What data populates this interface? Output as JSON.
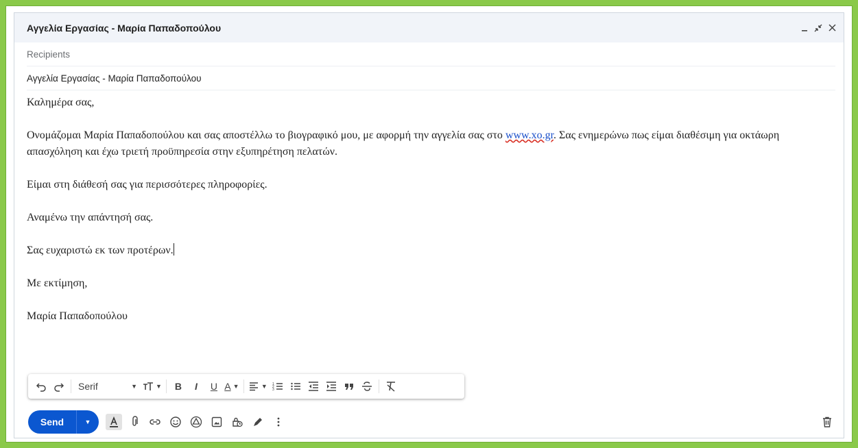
{
  "window": {
    "title": "Αγγελία Εργασίας - Μαρία Παπαδοπούλου",
    "minimize_icon": "minimize-icon",
    "expand_icon": "exit-fullscreen-icon",
    "close_icon": "close-icon"
  },
  "recipients": {
    "placeholder": "Recipients"
  },
  "subject": {
    "value": "Αγγελία Εργασίας - Μαρία Παπαδοπούλου"
  },
  "body": {
    "greeting": "Καλημέρα σας,",
    "para1_before": "Ονομάζομαι Μαρία Παπαδοπούλου και σας αποστέλλω το βιογραφικό μου, με αφορμή την αγγελία σας στο ",
    "para1_link": "www.xo.gr",
    "para1_after": ". Σας ενημερώνω πως είμαι διαθέσιμη για οκτάωρη απασχόληση και έχω τριετή προϋπηρεσία στην εξυπηρέτηση πελατών.",
    "para2": "Είμαι στη διάθεσή σας για περισσότερες πληροφορίες.",
    "para3": "Αναμένω την απάντησή σας.",
    "para4": "Σας ευχαριστώ εκ των προτέρων.",
    "closing": "Με εκτίμηση,",
    "signature": "Μαρία Παπαδοπούλου"
  },
  "format_toolbar": {
    "font": "Serif",
    "bold": "B",
    "italic": "I",
    "underline": "U",
    "text_color": "A"
  },
  "bottom_bar": {
    "send_label": "Send"
  },
  "colors": {
    "border_green": "#8ac94a",
    "send_blue": "#0b57d0",
    "link_blue": "#1a4fc9",
    "titlebar_bg": "#f1f4f9"
  }
}
